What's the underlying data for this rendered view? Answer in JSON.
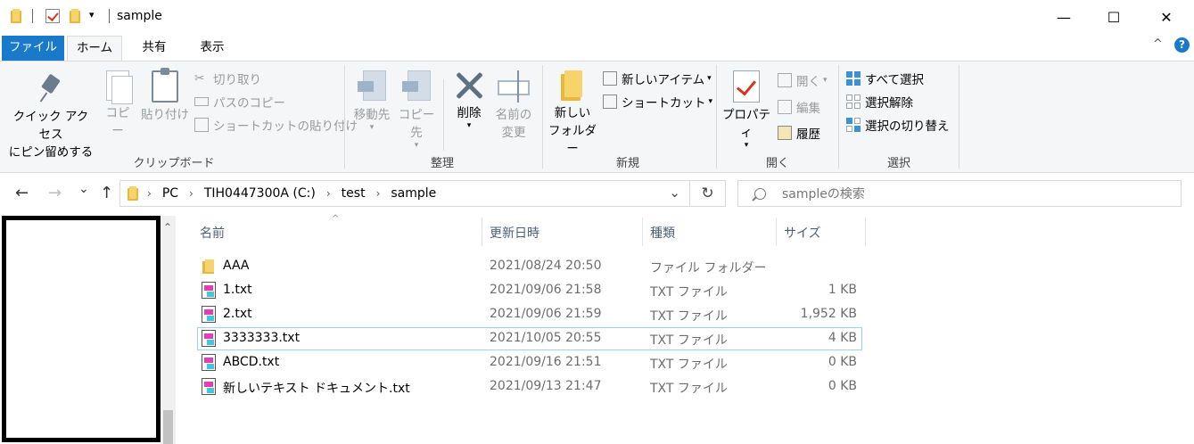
{
  "window": {
    "title": "sample",
    "minimize": "—",
    "maximize": "☐",
    "close": "✕"
  },
  "ribbon_tabs": [
    {
      "label": "ファイル"
    },
    {
      "label": "ホーム"
    },
    {
      "label": "共有"
    },
    {
      "label": "表示"
    }
  ],
  "ribbon_controls": {
    "collapse": "^",
    "help": "?"
  },
  "clipboard": {
    "pin_line1": "クイック アクセス",
    "pin_line2": "にピン留めする",
    "copy": "コピー",
    "paste": "貼り付け",
    "cut": "切り取り",
    "copy_path": "パスのコピー",
    "paste_shortcut": "ショートカットの貼り付け",
    "label": "クリップボード"
  },
  "organize": {
    "move_to": "移動先",
    "copy_to": "コピー先",
    "delete": "削除",
    "rename_line1": "名前の",
    "rename_line2": "変更",
    "label": "整理"
  },
  "new": {
    "new_item": "新しいアイテム",
    "shortcut": "ショートカット",
    "new_folder_line1": "新しい",
    "new_folder_line2": "フォルダー",
    "label": "新規"
  },
  "open": {
    "properties": "プロパティ",
    "open": "開く",
    "edit": "編集",
    "history": "履歴",
    "label": "開く"
  },
  "select": {
    "select_all": "すべて選択",
    "select_none": "選択解除",
    "invert": "選択の切り替え",
    "label": "選択"
  },
  "nav": {
    "back": "←",
    "forward": "→",
    "recent": "⌄",
    "up": "↑"
  },
  "breadcrumb": [
    "PC",
    "TIH0447300A (C:)",
    "test",
    "sample"
  ],
  "address": {
    "dropdown": "⌄",
    "refresh": "↻"
  },
  "search": {
    "placeholder": "sampleの検索"
  },
  "columns": {
    "name": "名前",
    "modified": "更新日時",
    "type": "種類",
    "size": "サイズ"
  },
  "files": [
    {
      "name": "AAA",
      "modified": "2021/08/24 20:50",
      "type": "ファイル フォルダー",
      "size": "",
      "icon": "folder-icon"
    },
    {
      "name": "1.txt",
      "modified": "2021/09/06 21:58",
      "type": "TXT ファイル",
      "size": "1 KB",
      "icon": "txt-file-icon"
    },
    {
      "name": "2.txt",
      "modified": "2021/09/06 21:59",
      "type": "TXT ファイル",
      "size": "1,952 KB",
      "icon": "txt-file-icon"
    },
    {
      "name": "3333333.txt",
      "modified": "2021/10/05 20:55",
      "type": "TXT ファイル",
      "size": "4 KB",
      "icon": "txt-file-icon",
      "selected": true
    },
    {
      "name": "ABCD.txt",
      "modified": "2021/09/16 21:51",
      "type": "TXT ファイル",
      "size": "0 KB",
      "icon": "txt-file-icon"
    },
    {
      "name": "新しいテキスト ドキュメント.txt",
      "modified": "2021/09/13 21:47",
      "type": "TXT ファイル",
      "size": "0 KB",
      "icon": "txt-file-icon"
    }
  ]
}
